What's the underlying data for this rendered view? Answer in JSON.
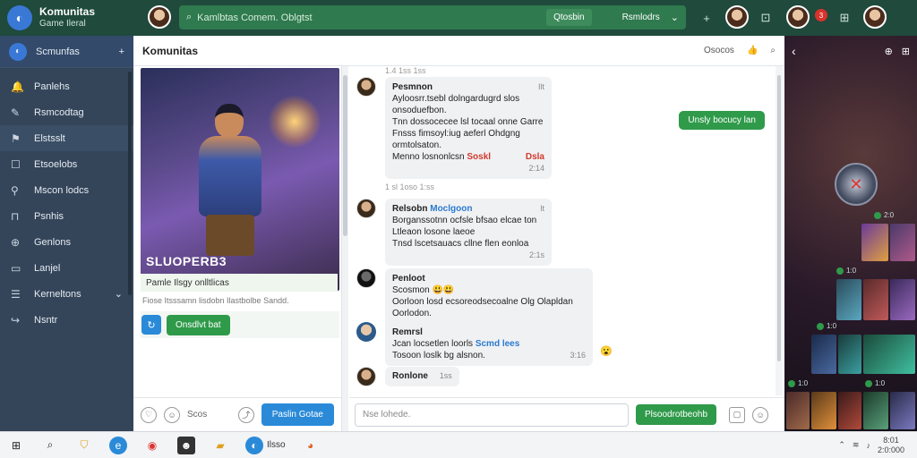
{
  "app": {
    "title": "Komunitas",
    "subtitle": "Game Ileral"
  },
  "topbar": {
    "search_placeholder": "Kamlbtas Comem. Oblgtst",
    "filter_pill": "Qtosbin",
    "filter_select": "Rsmlodrs",
    "notification_count": "3"
  },
  "sidebar": {
    "header": "Scmunfas",
    "items": [
      {
        "label": "Panlehs",
        "icon": "bell-icon"
      },
      {
        "label": "Rsmcodtag",
        "icon": "pen-icon"
      },
      {
        "label": "Elstsslt",
        "icon": "flag-icon"
      },
      {
        "label": "Etsoelobs",
        "icon": "chat-icon"
      },
      {
        "label": "Mscon lodcs",
        "icon": "pin-icon"
      },
      {
        "label": "Psnhis",
        "icon": "lock-icon"
      },
      {
        "label": "Genlons",
        "icon": "layers-icon"
      },
      {
        "label": "Lanjel",
        "icon": "file-icon"
      },
      {
        "label": "Kerneltons",
        "icon": "book-icon"
      },
      {
        "label": "Nsntr",
        "icon": "reply-icon"
      }
    ]
  },
  "main": {
    "title": "Komunitas",
    "header_right": "Osocos"
  },
  "post": {
    "title": "SLUOPERB3",
    "caption": "Pamle Ilsgy onlltlicas",
    "footer": "Fiose Itsssamn lisdobn Ilastbolbe Sandd.",
    "action_button": "Onsdlvt bat",
    "accent": "#2f9a4a"
  },
  "chat": {
    "top_time": "1.4 1ss 1ss",
    "own_message": "Unsly bocucy lan",
    "messages": [
      {
        "name": "Pesmnon",
        "side": "Ilt",
        "lines": [
          "Ayloosrr.tsebl dolngardugrd slos",
          "onsoduefbon.",
          "Tnn dossocecee lsl tocaal onne Garre",
          "Fnsss fimsoyl:iug aeferl Ohdgng",
          "ormtolsaton."
        ],
        "highlight_prefix": "Menno losnonlcsn",
        "highlight": "Soskl",
        "highlight_right": "Dsla",
        "meta": "2:14",
        "time": "1 sl 1oso 1:ss"
      },
      {
        "name": "Relsobn",
        "link": "Moclgoon",
        "side": "lt",
        "lines": [
          "Borganssotnn ocfsle bfsao elcae ton",
          "Ltleaon losone laeoe",
          "Tnsd lscetsauacs cllne flen eonloa"
        ],
        "meta": "2:1s"
      },
      {
        "name": "Penloot",
        "lines": [
          "Scosmon 😃😃",
          "Oorloon losd ecsoreodsecoalne Olg Olapldan",
          "Oorlodon."
        ]
      },
      {
        "name": "Remrsl",
        "lines": [
          "Jcan locsetlen loorls",
          "Tosoon loslk bg alsnon."
        ],
        "link": "Scmd lees",
        "meta": "3:16"
      },
      {
        "name": "Ronlone",
        "meta": "1ss"
      }
    ],
    "composer_placeholder": "Nse lohede.",
    "send_button": "Plsoodrotbeohb",
    "left_toolbar_label": "Scos",
    "left_toolbar_button": "Paslin Gotae"
  },
  "rpanel": {
    "tags": [
      "2:0",
      "1:0",
      "1:0",
      "1:0",
      "1:0"
    ]
  },
  "taskbar": {
    "app_label": "Ilsso",
    "time": "8:01",
    "date": "2:0:000"
  }
}
